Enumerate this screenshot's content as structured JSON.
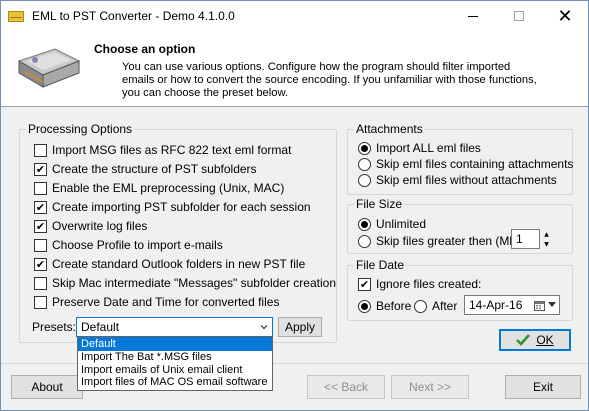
{
  "window": {
    "title": "EML to PST Converter - Demo 4.1.0.0"
  },
  "header": {
    "title": "Choose an option",
    "description": "You can use various options. Configure how the program should filter imported emails or how to convert the source encoding. If you unfamiliar with those functions, you can choose the preset below."
  },
  "processing": {
    "title": "Processing Options",
    "options": [
      {
        "label": "Import MSG files as RFC 822 text eml format",
        "checked": false
      },
      {
        "label": "Create the structure of PST subfolders",
        "checked": true
      },
      {
        "label": "Enable the EML preprocessing (Unix, MAC)",
        "checked": false
      },
      {
        "label": "Create importing PST subfolder for each session",
        "checked": true
      },
      {
        "label": "Overwrite log files",
        "checked": true
      },
      {
        "label": "Choose Profile to import e-mails",
        "checked": false
      },
      {
        "label": "Create standard Outlook folders in new PST file",
        "checked": true
      },
      {
        "label": "Skip Mac intermediate \"Messages\" subfolder creation",
        "checked": false
      },
      {
        "label": "Preserve Date and Time for converted files",
        "checked": false
      }
    ],
    "presets_label": "Presets:",
    "preset_value": "Default",
    "apply_label": "Apply",
    "preset_options": [
      "Default",
      "Import The Bat *.MSG files",
      "Import emails of Unix email client",
      "Import files of MAC OS email software"
    ]
  },
  "attachments": {
    "title": "Attachments",
    "options": [
      {
        "label": "Import ALL eml files",
        "selected": true
      },
      {
        "label": "Skip eml files containing attachments",
        "selected": false
      },
      {
        "label": "Skip eml files without attachments",
        "selected": false
      }
    ]
  },
  "filesize": {
    "title": "File Size",
    "unlimited_label": "Unlimited",
    "skip_label": "Skip files greater then (Mb):",
    "skip_value": "1",
    "selected": "unlimited"
  },
  "filedate": {
    "title": "File Date",
    "ignore_label": "Ignore files created:",
    "ignore_checked": true,
    "before_label": "Before",
    "after_label": "After",
    "selected": "before",
    "date_value": "14-Apr-16"
  },
  "footer": {
    "ok_label": "OK",
    "about_label": "About",
    "back_label": "<< Back",
    "next_label": "Next >>",
    "exit_label": "Exit"
  },
  "colors": {
    "accent": "#0078d7",
    "ok_check": "#2a9a2a"
  }
}
